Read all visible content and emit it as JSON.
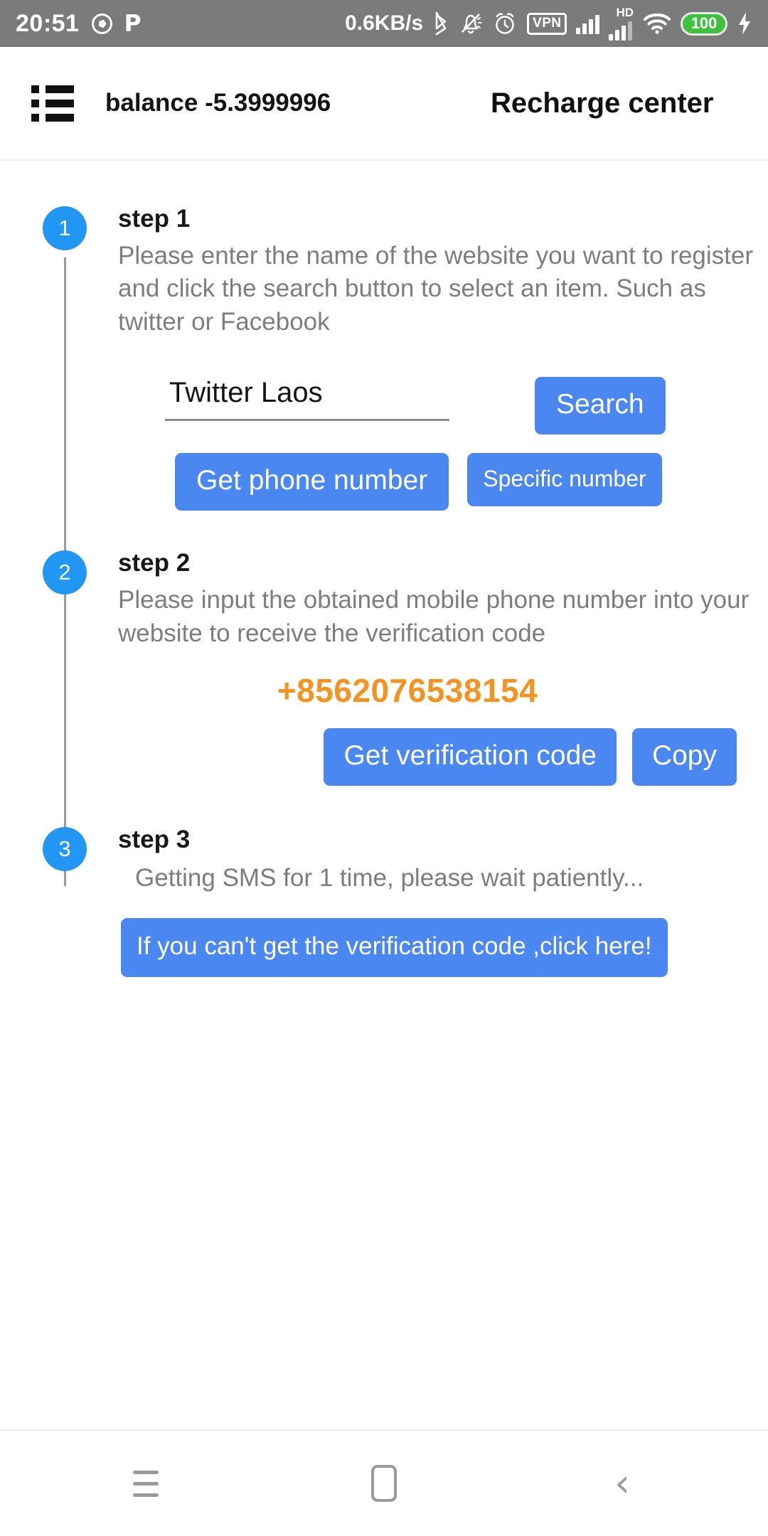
{
  "statusbar": {
    "time": "20:51",
    "network_speed": "0.6KB/s",
    "vpn_label": "VPN",
    "hd_label": "HD",
    "battery_level": "100",
    "icons": [
      "soccer-ball-icon",
      "p-app-icon",
      "bluetooth-icon",
      "bell-muted-icon",
      "alarm-clock-icon",
      "vpn-badge-icon",
      "signal-bars-icon",
      "signal-bars-hd-icon",
      "wifi-icon",
      "battery-icon",
      "charging-bolt-icon"
    ],
    "colors": {
      "background": "#7b7b7b",
      "battery_fill": "#3ec23e"
    }
  },
  "appbar": {
    "menu_icon": "list-menu-icon",
    "balance": "balance -5.3999996",
    "title": "Recharge center"
  },
  "theme": {
    "accent_blue": "#4a87f0",
    "badge_blue": "#2196f3",
    "phone_orange": "#f59320",
    "muted_text": "#7d7d7d"
  },
  "steps": [
    {
      "badge": "1",
      "title": "step 1",
      "description": "Please enter the name of the website you want to register and click the search button to select an item. Such as twitter or Facebook",
      "search_value": "Twitter Laos",
      "search_placeholder": "",
      "search_button": "Search",
      "get_phone_button": "Get phone number",
      "specific_number_button": "Specific number"
    },
    {
      "badge": "2",
      "title": "step 2",
      "description": "Please input the obtained mobile phone number into your website to receive the verification code",
      "phone_number": "+8562076538154",
      "get_code_button": "Get verification code",
      "copy_button": "Copy"
    },
    {
      "badge": "3",
      "title": "step 3",
      "description": "Getting SMS for 1 time, please wait patiently...",
      "help_button": "If you can't get the verification code ,click here!"
    }
  ],
  "navbar": {
    "recents": "recents-icon",
    "home": "home-icon",
    "back": "‹"
  }
}
